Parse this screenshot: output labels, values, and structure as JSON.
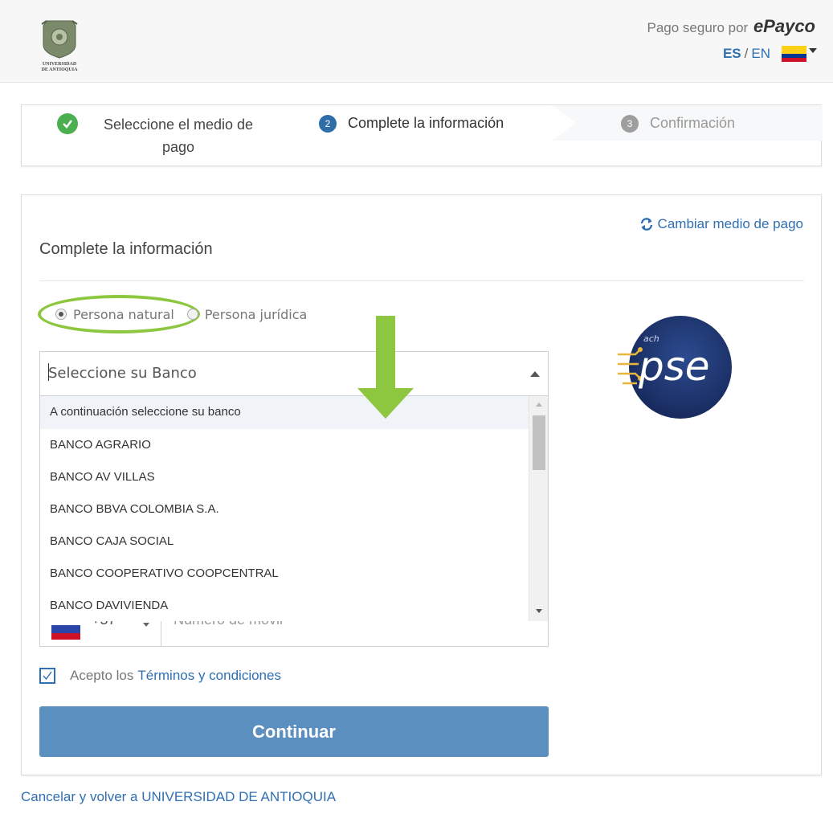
{
  "header": {
    "logo_line1": "UNIVERSIDAD",
    "logo_line2": "DE ANTIOQUIA",
    "secure_text": "Pago seguro por",
    "brand": "ePayco",
    "lang_es": "ES",
    "lang_sep": "/",
    "lang_en": "EN",
    "flag_colors": [
      "#fcd116",
      "#003893",
      "#ce1126"
    ]
  },
  "stepper": {
    "step1": {
      "label": "Seleccione el medio de pago",
      "status": "done"
    },
    "step2": {
      "num": "2",
      "label": "Complete la información",
      "status": "active"
    },
    "step3": {
      "num": "3",
      "label": "Confirmación",
      "status": "pending"
    }
  },
  "card": {
    "change_link": "Cambiar medio de pago",
    "title": "Complete la información",
    "radio_natural": "Persona natural",
    "radio_juridica": "Persona jurídica",
    "bank_placeholder": "Seleccione su Banco",
    "bank_options": [
      "A continuación seleccione su banco",
      "BANCO AGRARIO",
      "BANCO AV VILLAS",
      "BANCO BBVA COLOMBIA S.A.",
      "BANCO CAJA SOCIAL",
      "BANCO COOPERATIVO COOPCENTRAL",
      "BANCO DAVIVIENDA"
    ],
    "phone_code": "+57",
    "phone_placeholder": "Número de móvil",
    "terms_prefix": "Acepto los",
    "terms_link": "Términos y condiciones",
    "continue_label": "Continuar",
    "pse_label": "pse",
    "pse_small": "ach"
  },
  "cancel_link": "Cancelar y volver a UNIVERSIDAD DE ANTIOQUIA",
  "colors": {
    "accent": "#2f6fb3",
    "button": "#5b8fc0",
    "success": "#4bae4f",
    "highlight": "#8dc63f"
  }
}
